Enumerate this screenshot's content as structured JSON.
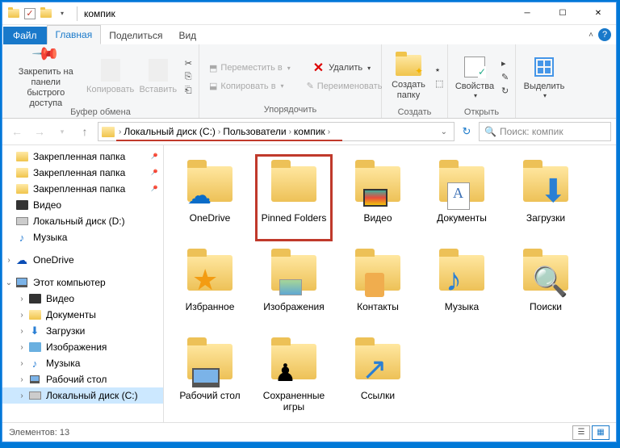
{
  "title": "компик",
  "tabs": {
    "file": "Файл",
    "home": "Главная",
    "share": "Поделиться",
    "view": "Вид"
  },
  "ribbon": {
    "pin": "Закрепить на панели\nбыстрого доступа",
    "copy": "Копировать",
    "paste": "Вставить",
    "clipboard_group": "Буфер обмена",
    "move_to": "Переместить в",
    "copy_to": "Копировать в",
    "delete": "Удалить",
    "rename": "Переименовать",
    "organize_group": "Упорядочить",
    "new_folder": "Создать\nпапку",
    "new_group": "Создать",
    "properties": "Свойства",
    "open_group": "Открыть",
    "select": "Выделить"
  },
  "breadcrumb": {
    "parts": [
      "Локальный диск (C:)",
      "Пользователи",
      "компик"
    ]
  },
  "search_placeholder": "Поиск: компик",
  "tree": {
    "pinned1": "Закрепленная папка",
    "pinned2": "Закрепленная папка",
    "pinned3": "Закрепленная папка",
    "video": "Видео",
    "disk_d": "Локальный диск (D:)",
    "music": "Музыка",
    "onedrive": "OneDrive",
    "this_pc": "Этот компьютер",
    "t_video": "Видео",
    "t_docs": "Документы",
    "t_down": "Загрузки",
    "t_pics": "Изображения",
    "t_music": "Музыка",
    "t_desk": "Рабочий стол",
    "t_disk_c": "Локальный диск (C:)"
  },
  "items": {
    "onedrive": "OneDrive",
    "pinned": "Pinned Folders",
    "video": "Видео",
    "docs": "Документы",
    "down": "Загрузки",
    "fav": "Избранное",
    "pics": "Изображения",
    "contacts": "Контакты",
    "music": "Музыка",
    "search": "Поиски",
    "desk": "Рабочий стол",
    "games": "Сохраненные\nигры",
    "links": "Ссылки"
  },
  "status": "Элементов: 13"
}
